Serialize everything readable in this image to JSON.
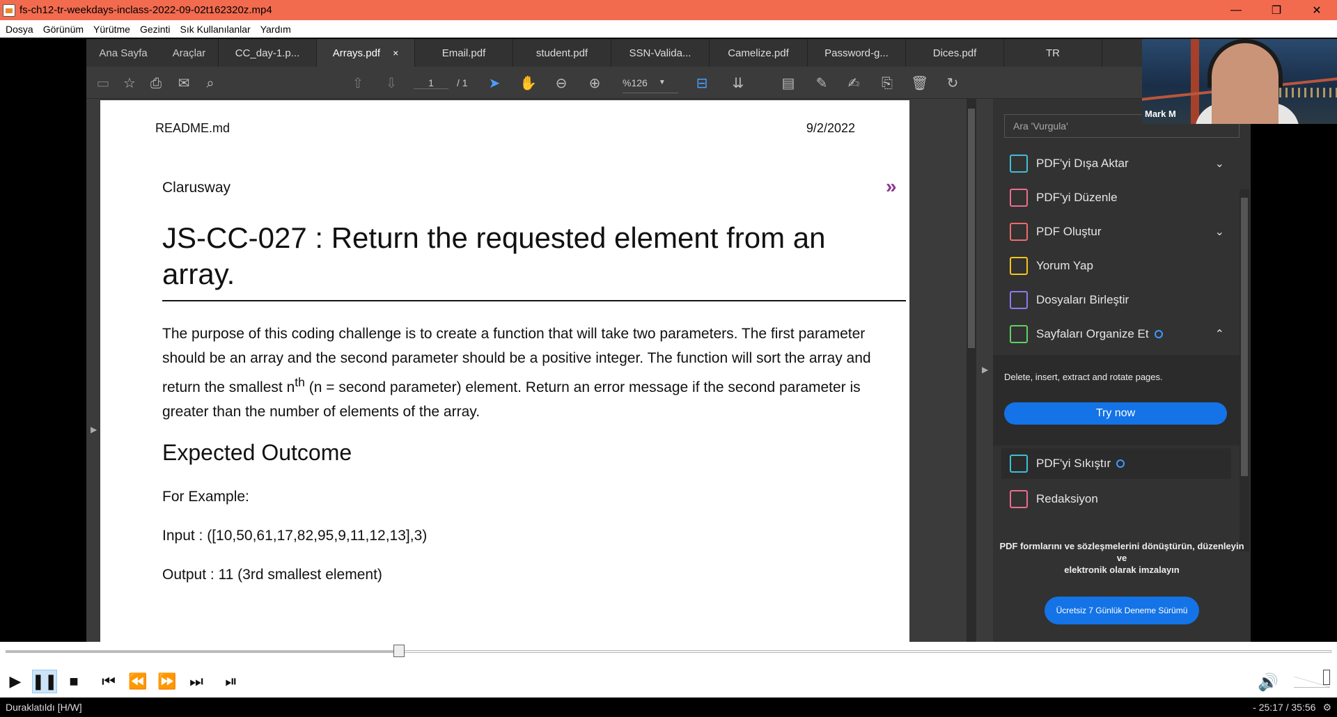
{
  "window": {
    "title": "fs-ch12-tr-weekdays-inclass-2022-09-02t162320z.mp4",
    "controls": [
      "—",
      "❐",
      "✕"
    ]
  },
  "menu": [
    {
      "label": "Dosya"
    },
    {
      "label": "Görünüm"
    },
    {
      "label": "Yürütme"
    },
    {
      "label": "Gezinti"
    },
    {
      "label": "Sık Kullanılanlar"
    },
    {
      "label": "Yardım"
    }
  ],
  "acrobat": {
    "home_tab": "Ana Sayfa",
    "tools_tab": "Araçlar",
    "tabs": [
      {
        "label": "CC_day-1.p..."
      },
      {
        "label": "Arrays.pdf",
        "close": "×"
      },
      {
        "label": "Email.pdf"
      },
      {
        "label": "student.pdf"
      },
      {
        "label": "SSN-Valida..."
      },
      {
        "label": "Camelize.pdf"
      },
      {
        "label": "Password-g..."
      },
      {
        "label": "Dices.pdf"
      },
      {
        "label": "TR"
      }
    ],
    "page_current": "1",
    "page_total": "/ 1",
    "zoom": "%126",
    "search_placeholder": "Ara 'Vurgula'",
    "tools": [
      {
        "label": "PDF'yi Dışa Aktar",
        "color": "#3fbfd6",
        "chevron": "⌄"
      },
      {
        "label": "PDF'yi Düzenle",
        "color": "#ef6b8f",
        "chevron": ""
      },
      {
        "label": "PDF Oluştur",
        "color": "#ef6b6b",
        "chevron": "⌄"
      },
      {
        "label": "Yorum Yap",
        "color": "#f5c518",
        "chevron": ""
      },
      {
        "label": "Dosyaları Birleştir",
        "color": "#8a7bf0",
        "chevron": ""
      },
      {
        "label": "Sayfaları Organize Et",
        "color": "#5fd35f",
        "chevron": "⌃",
        "badge": true
      }
    ],
    "organize_desc": "Delete, insert, extract and rotate pages.",
    "try_now": "Try now",
    "compress_label": "PDF'yi Sıkıştır",
    "redact_label": "Redaksiyon",
    "promo_line1": "PDF formlarını ve sözleşmelerini dönüştürün, düzenleyin",
    "promo_line2": "ve",
    "promo_line3": "elektronik olarak imzalayın",
    "promo_button": "Ücretsiz 7 Günlük Deneme Sürümü"
  },
  "document": {
    "header_left": "README.md",
    "header_right": "9/2/2022",
    "brand": "Clarusway",
    "brand_icon": "»",
    "title": "JS-CC-027 : Return the requested element from an array.",
    "para_part1": "The purpose of this coding challenge is to create a function that will take two parameters. The first parameter should be an array and the second parameter should be a positive integer. The function will sort the array and return the smallest n",
    "para_sup": "th",
    "para_part2": " (n = second parameter) element. Return an error message if the second parameter is greater than the number of elements of the array.",
    "subtitle": "Expected Outcome",
    "for_example": "For Example:",
    "input": "Input : ([10,50,61,17,82,95,9,11,12,13],3)",
    "output": "Output : 11 (3rd smallest element)"
  },
  "webcam": {
    "name": "Mark M"
  },
  "player": {
    "progress": 0.297,
    "status_left": "Duraklatıldı [H/W]",
    "time": "- 25:17 / 35:56"
  }
}
